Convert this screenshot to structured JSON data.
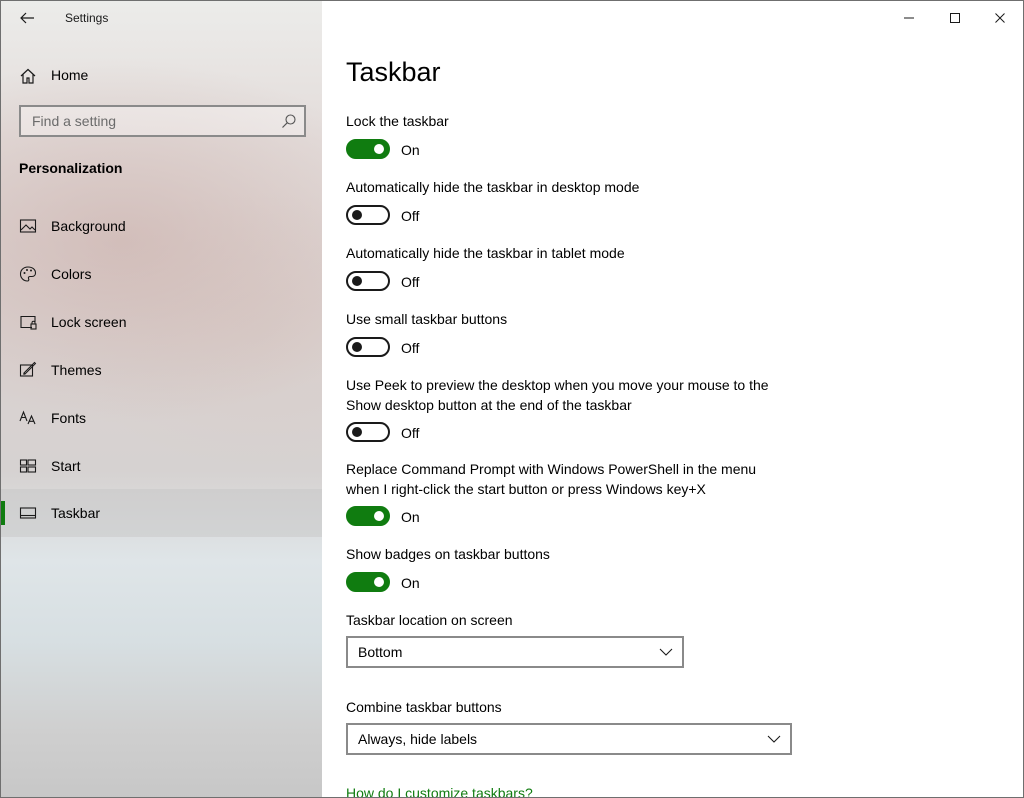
{
  "app": {
    "title": "Settings"
  },
  "sidebar": {
    "home_label": "Home",
    "search_placeholder": "Find a setting",
    "section_header": "Personalization",
    "items": [
      {
        "label": "Background",
        "icon": "picture-icon"
      },
      {
        "label": "Colors",
        "icon": "palette-icon"
      },
      {
        "label": "Lock screen",
        "icon": "lock-screen-icon"
      },
      {
        "label": "Themes",
        "icon": "themes-icon"
      },
      {
        "label": "Fonts",
        "icon": "fonts-icon"
      },
      {
        "label": "Start",
        "icon": "start-icon"
      },
      {
        "label": "Taskbar",
        "icon": "taskbar-icon",
        "selected": true
      }
    ]
  },
  "main": {
    "title": "Taskbar",
    "settings": [
      {
        "label": "Lock the taskbar",
        "state": "On"
      },
      {
        "label": "Automatically hide the taskbar in desktop mode",
        "state": "Off"
      },
      {
        "label": "Automatically hide the taskbar in tablet mode",
        "state": "Off"
      },
      {
        "label": "Use small taskbar buttons",
        "state": "Off"
      },
      {
        "label": "Use Peek to preview the desktop when you move your mouse to the Show desktop button at the end of the taskbar",
        "state": "Off"
      },
      {
        "label": "Replace Command Prompt with Windows PowerShell in the menu when I right-click the start button or press Windows key+X",
        "state": "On"
      },
      {
        "label": "Show badges on taskbar buttons",
        "state": "On"
      }
    ],
    "location": {
      "label": "Taskbar location on screen",
      "value": "Bottom"
    },
    "combine": {
      "label": "Combine taskbar buttons",
      "value": "Always, hide labels"
    },
    "help_link": "How do I customize taskbars?"
  },
  "colors": {
    "accent": "#107c10"
  }
}
